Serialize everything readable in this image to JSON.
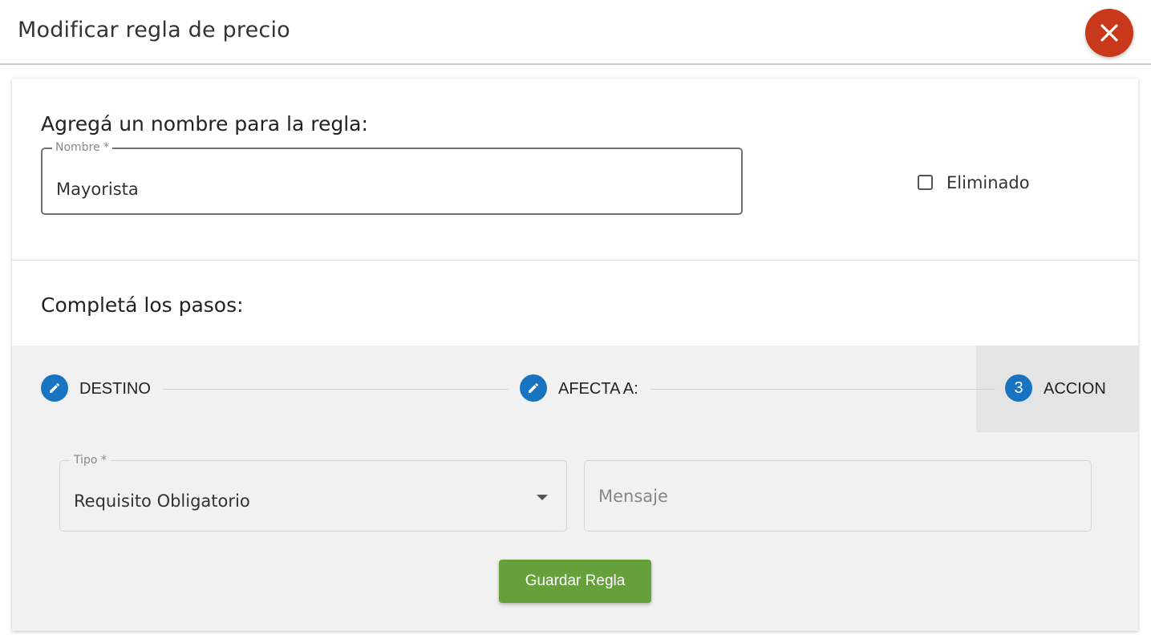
{
  "header": {
    "title": "Modificar regla de precio",
    "close_icon": "close-icon",
    "close_color": "#c9381a"
  },
  "name_section": {
    "heading": "Agregá un nombre para la regla:",
    "field_label": "Nombre *",
    "field_value": "Mayorista",
    "checkbox_label": "Eliminado",
    "checkbox_checked": false
  },
  "steps_section": {
    "heading": "Completá los pasos:",
    "steps": [
      {
        "label": "DESTINO",
        "icon": "pencil-icon",
        "state": "edited"
      },
      {
        "label": "AFECTA A:",
        "icon": "pencil-icon",
        "state": "edited"
      },
      {
        "label": "ACCION",
        "number": "3",
        "state": "active"
      }
    ],
    "step_color": "#1874c1"
  },
  "action_form": {
    "tipo_label": "Tipo *",
    "tipo_value": "Requisito Obligatorio",
    "mensaje_placeholder": "Mensaje",
    "save_label": "Guardar Regla",
    "save_color": "#66a03a"
  }
}
